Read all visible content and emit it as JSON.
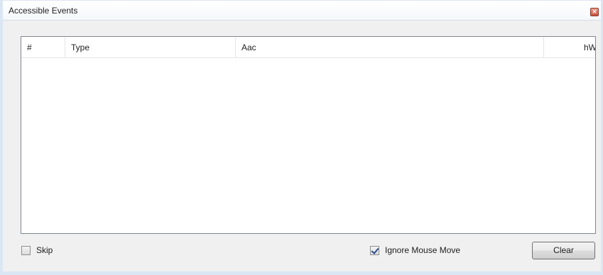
{
  "window": {
    "title": "Accessible Events",
    "close_glyph": "×"
  },
  "list": {
    "columns": [
      "#",
      "Type",
      "Aac",
      "hW"
    ],
    "rows": []
  },
  "options": {
    "skip": {
      "label": "Skip",
      "checked": false
    },
    "ignore_mouse_move": {
      "label": "Ignore Mouse Move",
      "checked": true
    }
  },
  "buttons": {
    "clear_label": "Clear"
  }
}
